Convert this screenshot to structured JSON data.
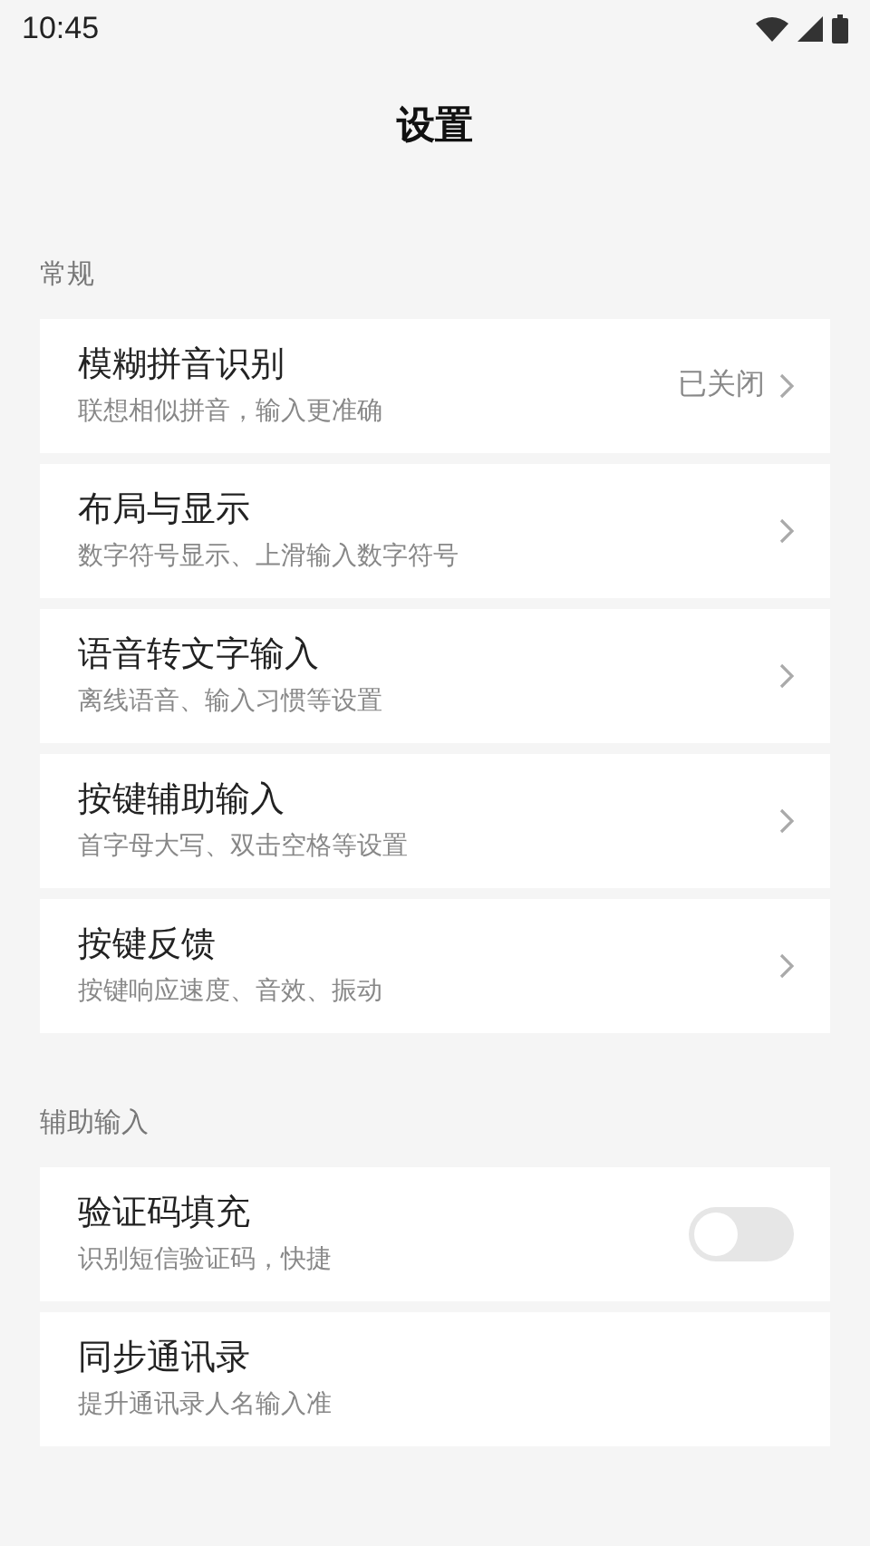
{
  "status_bar": {
    "time": "10:45"
  },
  "title": "设置",
  "sections": [
    {
      "header": "常规",
      "items": [
        {
          "kind": "nav",
          "title": "模糊拼音识别",
          "subtitle": "联想相似拼音，输入更准确",
          "value": "已关闭"
        },
        {
          "kind": "nav",
          "title": "布局与显示",
          "subtitle": "数字符号显示、上滑输入数字符号"
        },
        {
          "kind": "nav",
          "title": "语音转文字输入",
          "subtitle": "离线语音、输入习惯等设置"
        },
        {
          "kind": "nav",
          "title": "按键辅助输入",
          "subtitle": "首字母大写、双击空格等设置"
        },
        {
          "kind": "nav",
          "title": "按键反馈",
          "subtitle": "按键响应速度、音效、振动"
        }
      ]
    },
    {
      "header": "辅助输入",
      "items": [
        {
          "kind": "toggle",
          "title": "验证码填充",
          "subtitle": "识别短信验证码，快捷",
          "on": false
        },
        {
          "kind": "plain",
          "title": "同步通讯录",
          "subtitle": "提升通讯录人名输入准"
        }
      ]
    }
  ]
}
